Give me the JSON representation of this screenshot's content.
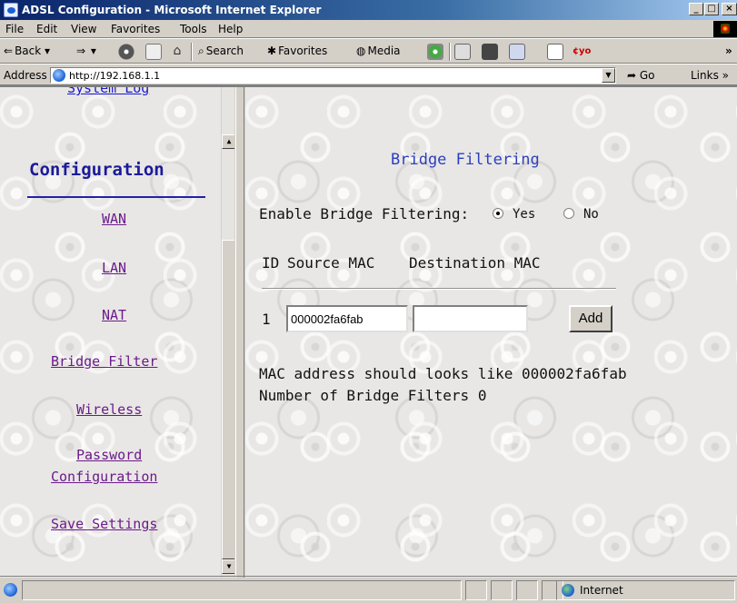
{
  "window": {
    "title": "ADSL Configuration - Microsoft Internet Explorer"
  },
  "menu": [
    "File",
    "Edit",
    "View",
    "Favorites",
    "Tools",
    "Help"
  ],
  "toolbar": {
    "back": "Back",
    "search": "Search",
    "favorites": "Favorites",
    "media": "Media"
  },
  "address": {
    "label": "Address",
    "url": "http://192.168.1.1",
    "go": "Go",
    "links": "Links"
  },
  "sidebar": {
    "partial_link": "System Log",
    "section": "Configuration",
    "links": [
      "WAN",
      "LAN",
      "NAT",
      "Bridge Filter",
      "Wireless",
      "Password",
      "Configuration",
      "Save Settings"
    ]
  },
  "main": {
    "title": "Bridge Filtering",
    "enable_label": "Enable Bridge Filtering:",
    "yes": "Yes",
    "no": "No",
    "enable_value": "Yes",
    "col_id": "ID",
    "col_source": "Source MAC",
    "col_dest": "Destination MAC",
    "row_id": "1",
    "source_value": "000002fa6fab",
    "dest_value": "",
    "add_button": "Add",
    "hint": "MAC address should looks like 000002fa6fab",
    "count_label": "Number of Bridge Filters 0"
  },
  "status": {
    "zone": "Internet"
  }
}
